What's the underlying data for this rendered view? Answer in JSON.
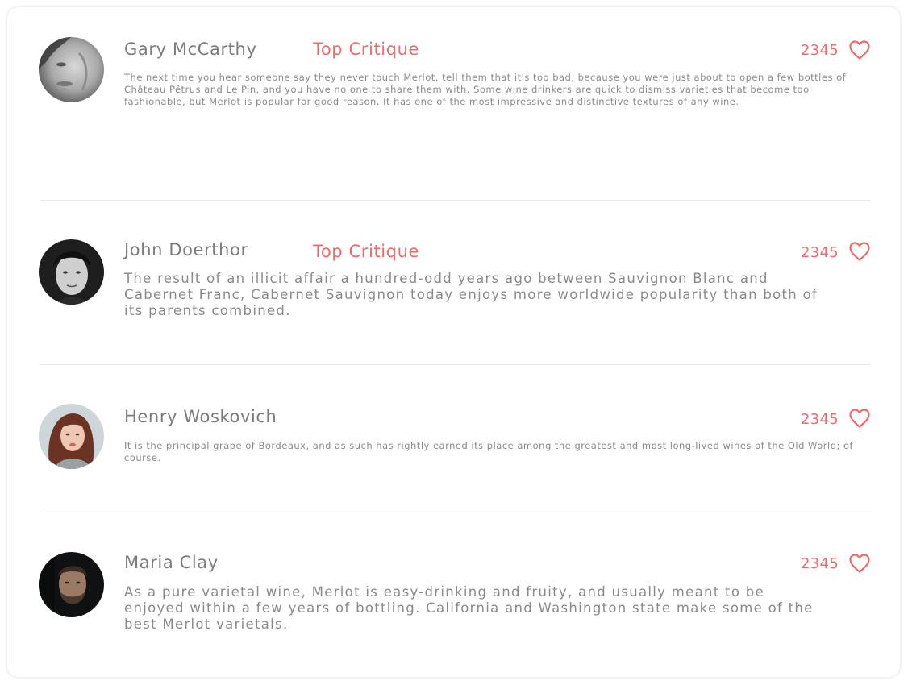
{
  "reviews": [
    {
      "name": "Gary McCarthy",
      "badge": "Top Critique",
      "likes": "2345",
      "avatar_icon": "male-portrait-avatar",
      "text": "The next time you hear someone say they never touch Merlot, tell them that it's too bad, because you were just about to open a few bottles of Château Pêtrus and Le Pin, and you have no one to share them with. Some wine drinkers are quick to dismiss varieties that become too fashionable, but Merlot is popular for good reason. It has one of the most impressive and distinctive textures of any wine."
    },
    {
      "name": "John Doerthor",
      "badge": "Top Critique",
      "likes": "2345",
      "avatar_icon": "male-portrait-avatar",
      "text": "The result of an illicit affair a hundred-odd years ago between Sauvignon Blanc and Cabernet Franc, Cabernet Sauvignon today enjoys more worldwide popularity than both of its parents combined."
    },
    {
      "name": "Henry Woskovich",
      "likes": "2345",
      "avatar_icon": "female-portrait-avatar",
      "text": "It is the principal grape of Bordeaux, and as such has rightly earned its place among the greatest and most long-lived wines of the Old World; of course."
    },
    {
      "name": "Maria Clay",
      "likes": "2345",
      "avatar_icon": "male-portrait-avatar",
      "text": "As a pure varietal wine, Merlot is easy-drinking and fruity, and usually meant to be enjoyed within a few years of bottling. California and Washington state make some of the best Merlot varietals."
    }
  ],
  "colors": {
    "accent": "#ef6b6b",
    "text": "#8a8a8a",
    "name": "#7b7b7b",
    "divider": "#e9e9e9"
  },
  "icons": {
    "like": "heart-outline-icon"
  }
}
